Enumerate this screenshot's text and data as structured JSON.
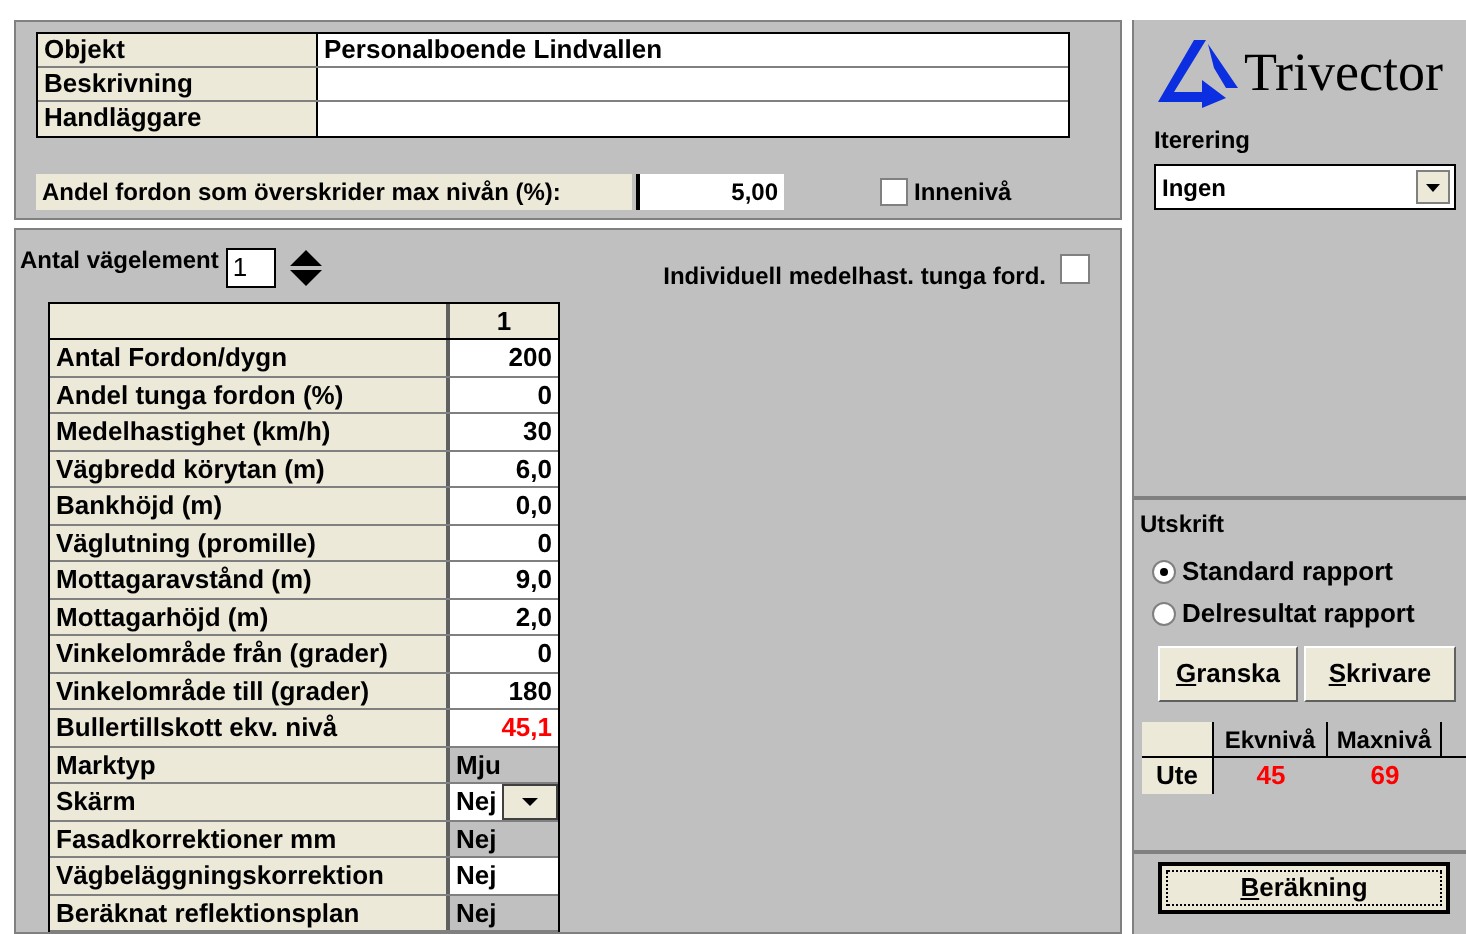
{
  "project": {
    "fields": [
      {
        "label": "Objekt",
        "value": "Personalboende Lindvallen"
      },
      {
        "label": "Beskrivning"
      },
      {
        "label": "Handläggare"
      }
    ],
    "exceed": {
      "label": "Andel fordon som överskrider max nivån (%):",
      "value": "5,00"
    },
    "indoor": {
      "label": "Innenivå",
      "checked": false
    }
  },
  "road_elements": {
    "label": "Antal vägelement",
    "count": "1",
    "individual": {
      "label": "Individuell medelhast. tunga ford.",
      "checked": false
    },
    "table": {
      "columns": [
        "1"
      ],
      "rows": [
        {
          "label": "Antal Fordon/dygn",
          "value": "200",
          "kind": "input"
        },
        {
          "label": "Andel tunga fordon (%)",
          "value": "0",
          "kind": "input"
        },
        {
          "label": "Medelhastighet (km/h)",
          "value": "30",
          "kind": "input"
        },
        {
          "label": "Vägbredd körytan (m)",
          "value": "6,0",
          "kind": "input"
        },
        {
          "label": "Bankhöjd (m)",
          "value": "0,0",
          "kind": "input"
        },
        {
          "label": "Väglutning (promille)",
          "value": "0",
          "kind": "input"
        },
        {
          "label": "Mottagaravstånd (m)",
          "value": "9,0",
          "kind": "input"
        },
        {
          "label": "Mottagarhöjd (m)",
          "value": "2,0",
          "kind": "input"
        },
        {
          "label": "Vinkelområde från (grader)",
          "value": "0",
          "kind": "input"
        },
        {
          "label": "Vinkelområde till (grader)",
          "value": "180",
          "kind": "input"
        },
        {
          "label": "Bullertillskott ekv. nivå",
          "value": "45,1",
          "kind": "computed"
        },
        {
          "label": "Marktyp",
          "value": "Mju",
          "kind": "readonly"
        },
        {
          "label": "Skärm",
          "value": "Nej",
          "kind": "select"
        },
        {
          "label": "Fasadkorrektioner mm",
          "value": "Nej",
          "kind": "readonly"
        },
        {
          "label": "Vägbeläggningskorrektion",
          "value": "Nej",
          "kind": "text"
        },
        {
          "label": "Beräknat reflektionsplan",
          "value": "Nej",
          "kind": "readonly"
        }
      ]
    }
  },
  "logo": {
    "text": "Trivector"
  },
  "iteration": {
    "label": "Iterering",
    "value": "Ingen"
  },
  "print": {
    "title": "Utskrift",
    "options": [
      {
        "label": "Standard rapport",
        "selected": true
      },
      {
        "label": "Delresultat rapport",
        "selected": false
      }
    ],
    "buttons": [
      "Granska",
      "Skrivare"
    ],
    "results": {
      "columns": [
        "Ekvnivå",
        "Maxnivå"
      ],
      "rows": [
        {
          "label": "Ute",
          "values": [
            "45",
            "69"
          ]
        }
      ]
    }
  },
  "calculate_button": "Beräkning"
}
